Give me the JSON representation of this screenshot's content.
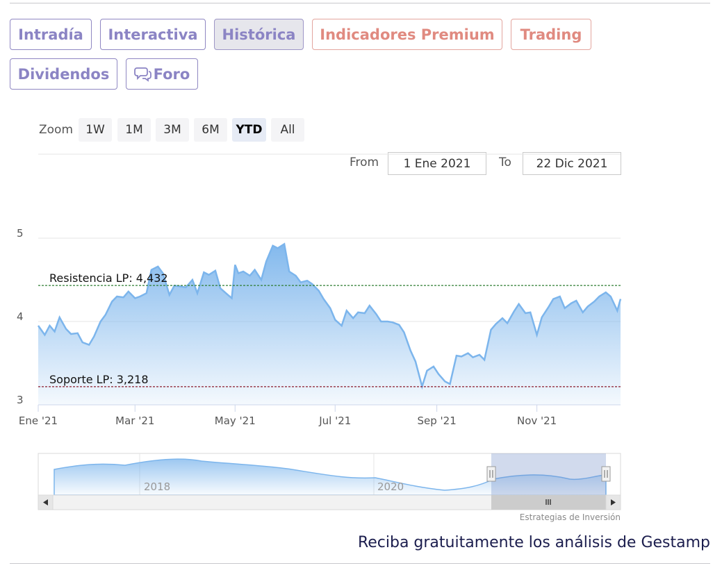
{
  "tabs": [
    {
      "label": "Intradía",
      "style": "normal"
    },
    {
      "label": "Interactiva",
      "style": "normal"
    },
    {
      "label": "Histórica",
      "style": "active"
    },
    {
      "label": "Indicadores Premium",
      "style": "premium"
    },
    {
      "label": "Trading",
      "style": "premium"
    },
    {
      "label": "Dividendos",
      "style": "normal"
    },
    {
      "label": "Foro",
      "style": "normal",
      "icon": "chat-bubbles-icon"
    }
  ],
  "zoom": {
    "label": "Zoom",
    "options": [
      "1W",
      "1M",
      "3M",
      "6M",
      "YTD",
      "All"
    ],
    "selected": "YTD"
  },
  "range": {
    "from_label": "From",
    "from_value": "1 Ene 2021",
    "to_label": "To",
    "to_value": "22 Dic 2021"
  },
  "navigator": {
    "year_labels": [
      "2018",
      "2020"
    ],
    "credit": "Estrategias de Inversión"
  },
  "footer": {
    "text": "Reciba gratuitamente los análisis de Gestamp"
  },
  "colors": {
    "series_line": "#7cb5ec",
    "resistance_line": "#2e7d32",
    "support_line": "#8b1a2b",
    "tab_text": "#8b84c4",
    "premium_text": "#e08a80",
    "footer_text": "#1b1d4d"
  },
  "chart_data": {
    "type": "area",
    "title": "",
    "xlabel": "",
    "ylabel": "",
    "ylim": [
      3,
      5
    ],
    "yticks": [
      "5",
      "4",
      "3"
    ],
    "xtick_labels": [
      "Ene '21",
      "Mar '21",
      "May '21",
      "Jul '21",
      "Sep '21",
      "Nov '21"
    ],
    "x_range": [
      "2021-01-01",
      "2021-12-22"
    ],
    "grid": true,
    "series": [
      {
        "x": [
          "2021-01-01",
          "2021-01-05",
          "2021-01-08",
          "2021-01-11",
          "2021-01-14",
          "2021-01-18",
          "2021-01-21",
          "2021-01-25",
          "2021-01-28",
          "2021-02-01",
          "2021-02-04",
          "2021-02-08",
          "2021-02-11",
          "2021-02-15",
          "2021-02-18",
          "2021-02-22",
          "2021-02-25",
          "2021-03-01",
          "2021-03-04",
          "2021-03-08",
          "2021-03-11",
          "2021-03-15",
          "2021-03-18",
          "2021-03-22",
          "2021-03-25",
          "2021-03-29",
          "2021-04-01",
          "2021-04-05",
          "2021-04-08",
          "2021-04-12",
          "2021-04-15",
          "2021-04-19",
          "2021-04-22",
          "2021-04-26",
          "2021-04-29",
          "2021-05-01",
          "2021-05-03",
          "2021-05-06",
          "2021-05-10",
          "2021-05-13",
          "2021-05-17",
          "2021-05-20",
          "2021-05-24",
          "2021-05-27",
          "2021-05-31",
          "2021-06-03",
          "2021-06-07",
          "2021-06-10",
          "2021-06-14",
          "2021-06-17",
          "2021-06-21",
          "2021-06-24",
          "2021-06-28",
          "2021-07-01",
          "2021-07-05",
          "2021-07-08",
          "2021-07-12",
          "2021-07-15",
          "2021-07-19",
          "2021-07-22",
          "2021-07-26",
          "2021-07-29",
          "2021-08-02",
          "2021-08-05",
          "2021-08-09",
          "2021-08-12",
          "2021-08-16",
          "2021-08-19",
          "2021-08-23",
          "2021-08-26",
          "2021-08-30",
          "2021-09-02",
          "2021-09-06",
          "2021-09-09",
          "2021-09-13",
          "2021-09-16",
          "2021-09-20",
          "2021-09-23",
          "2021-09-27",
          "2021-09-30",
          "2021-10-04",
          "2021-10-07",
          "2021-10-11",
          "2021-10-14",
          "2021-10-18",
          "2021-10-21",
          "2021-10-25",
          "2021-10-28",
          "2021-11-01",
          "2021-11-04",
          "2021-11-08",
          "2021-11-11",
          "2021-11-15",
          "2021-11-18",
          "2021-11-22",
          "2021-11-25",
          "2021-11-29",
          "2021-12-02",
          "2021-12-06",
          "2021-12-09",
          "2021-12-13",
          "2021-12-16",
          "2021-12-20",
          "2021-12-22"
        ],
        "values": [
          3.95,
          3.84,
          3.95,
          3.88,
          4.05,
          3.91,
          3.85,
          3.86,
          3.75,
          3.72,
          3.82,
          4.0,
          4.08,
          4.24,
          4.3,
          4.29,
          4.36,
          4.28,
          4.3,
          4.34,
          4.62,
          4.66,
          4.58,
          4.32,
          4.43,
          4.42,
          4.41,
          4.5,
          4.34,
          4.59,
          4.56,
          4.61,
          4.4,
          4.33,
          4.28,
          4.68,
          4.58,
          4.6,
          4.55,
          4.62,
          4.5,
          4.72,
          4.91,
          4.88,
          4.93,
          4.6,
          4.55,
          4.47,
          4.49,
          4.45,
          4.37,
          4.27,
          4.16,
          4.02,
          3.95,
          4.13,
          4.04,
          4.11,
          4.1,
          4.19,
          4.09,
          4.0,
          4.0,
          3.99,
          3.96,
          3.87,
          3.65,
          3.52,
          3.22,
          3.41,
          3.46,
          3.37,
          3.28,
          3.25,
          3.59,
          3.58,
          3.62,
          3.57,
          3.6,
          3.54,
          3.9,
          3.97,
          4.04,
          3.98,
          4.12,
          4.21,
          4.1,
          4.11,
          3.84,
          4.05,
          4.17,
          4.27,
          4.3,
          4.16,
          4.22,
          4.25,
          4.11,
          4.18,
          4.24,
          4.3,
          4.35,
          4.3,
          4.13,
          4.27
        ]
      }
    ],
    "annotations": [
      {
        "text": "Resistencia LP: 4,432",
        "y": 4.432,
        "color": "#2e7d32"
      },
      {
        "text": "Soporte LP: 3,218",
        "y": 3.218,
        "color": "#8b1a2b"
      }
    ]
  }
}
